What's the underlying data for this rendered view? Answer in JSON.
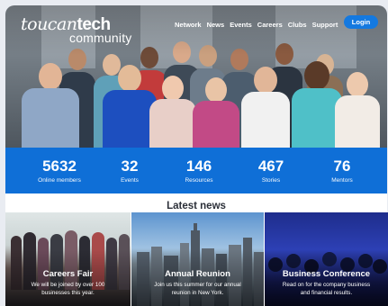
{
  "brand": {
    "logo_script": "toucan",
    "logo_bold": "tech",
    "logo_sub": "community"
  },
  "nav": {
    "items": [
      "Network",
      "News",
      "Events",
      "Careers",
      "Clubs",
      "Support"
    ],
    "login_label": "Login"
  },
  "stats": [
    {
      "value": "5632",
      "label": "Online members"
    },
    {
      "value": "32",
      "label": "Events"
    },
    {
      "value": "146",
      "label": "Resources"
    },
    {
      "value": "467",
      "label": "Stories"
    },
    {
      "value": "76",
      "label": "Mentors"
    }
  ],
  "news": {
    "heading": "Latest news",
    "cards": [
      {
        "title": "Careers Fair",
        "line1": "We will be joined by over 100",
        "line2": "businesses this year."
      },
      {
        "title": "Annual Reunion",
        "line1": "Join us this summer for our annual",
        "line2": "reunion in New York."
      },
      {
        "title": "Business Conference",
        "line1": "Read on for the company business",
        "line2": "and financial results."
      }
    ]
  },
  "colors": {
    "brand_blue": "#0f6fd7",
    "login_blue": "#1479e0",
    "heading_text": "#2b2f38"
  }
}
